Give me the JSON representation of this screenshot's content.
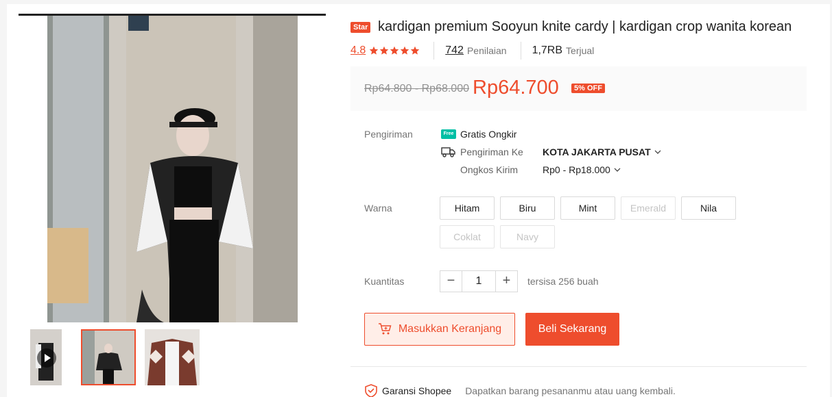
{
  "product": {
    "badge": "Star",
    "title": "kardigan premium Sooyun knite cardy | kardigan crop wanita korean"
  },
  "stats": {
    "rating": "4.8",
    "stars": 5,
    "reviews_count": "742",
    "reviews_label": "Penilaian",
    "sold_count": "1,7RB",
    "sold_label": "Terjual"
  },
  "price": {
    "original": "Rp64.800 - Rp68.000",
    "current": "Rp64.700",
    "discount": "5% OFF"
  },
  "shipping": {
    "label": "Pengiriman",
    "free_badge": "Free",
    "free_text": "Gratis Ongkir",
    "to_label": "Pengiriman Ke",
    "to_value": "KOTA JAKARTA PUSAT",
    "cost_label": "Ongkos Kirim",
    "cost_value": "Rp0 - Rp18.000"
  },
  "variants": {
    "label": "Warna",
    "options": [
      {
        "label": "Hitam",
        "available": true
      },
      {
        "label": "Biru",
        "available": true
      },
      {
        "label": "Mint",
        "available": true
      },
      {
        "label": "Emerald",
        "available": false
      },
      {
        "label": "Nila",
        "available": true
      },
      {
        "label": "Coklat",
        "available": false
      },
      {
        "label": "Navy",
        "available": false
      }
    ]
  },
  "quantity": {
    "label": "Kuantitas",
    "minus": "−",
    "value": "1",
    "plus": "+",
    "stock": "tersisa 256 buah"
  },
  "actions": {
    "add_to_cart": "Masukkan Keranjang",
    "buy_now": "Beli Sekarang"
  },
  "guarantee": {
    "title": "Garansi Shopee",
    "desc": "Dapatkan barang pesananmu atau uang kembali."
  },
  "colors": {
    "accent": "#ee4d2d",
    "free_badge": "#00bfa5"
  }
}
